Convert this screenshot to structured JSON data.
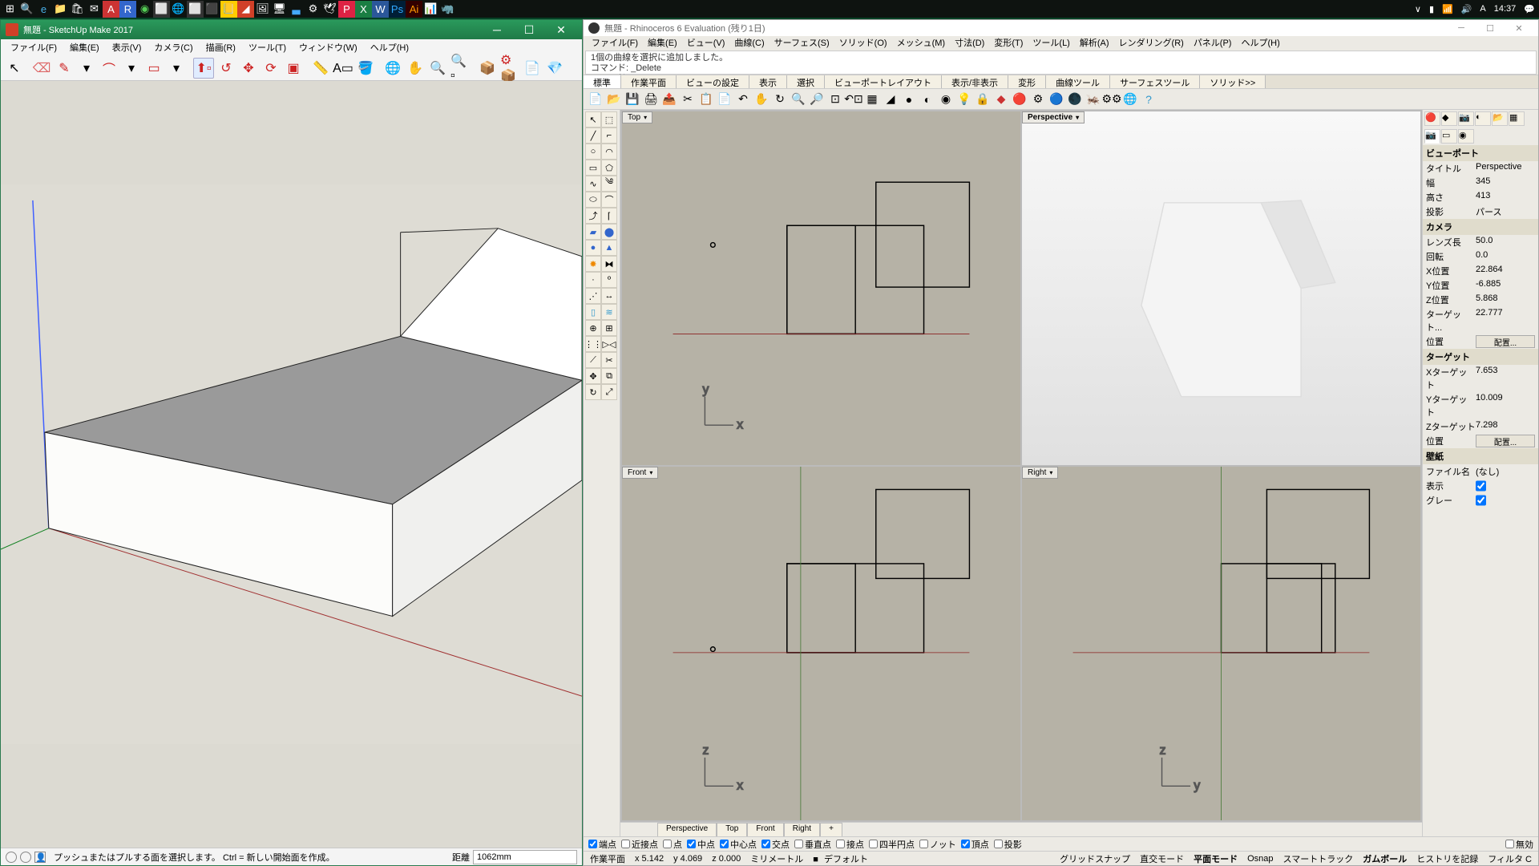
{
  "taskbar": {
    "time": "14:37",
    "indicators": [
      "∨",
      "📶",
      "🔊",
      "A",
      "14:37",
      "💬"
    ]
  },
  "sketchup": {
    "title": "無題 - SketchUp Make 2017",
    "menu": [
      "ファイル(F)",
      "編集(E)",
      "表示(V)",
      "カメラ(C)",
      "描画(R)",
      "ツール(T)",
      "ウィンドウ(W)",
      "ヘルプ(H)"
    ],
    "status_hint": "プッシュまたはプルする面を選択します。 Ctrl = 新しい開始面を作成。",
    "distance_label": "距離",
    "distance_value": "1062mm"
  },
  "rhino": {
    "title": "無題 - Rhinoceros 6 Evaluation (残り1日)",
    "menu": [
      "ファイル(F)",
      "編集(E)",
      "ビュー(V)",
      "曲線(C)",
      "サーフェス(S)",
      "ソリッド(O)",
      "メッシュ(M)",
      "寸法(D)",
      "変形(T)",
      "ツール(L)",
      "解析(A)",
      "レンダリング(R)",
      "パネル(P)",
      "ヘルプ(H)"
    ],
    "cmd_history": "1個の曲線を選択に追加しました。",
    "cmd_last": "コマンド: _Delete",
    "cmd_prompt": "コマンド:",
    "tabs": [
      "標準",
      "作業平面",
      "ビューの設定",
      "表示",
      "選択",
      "ビューポートレイアウト",
      "表示/非表示",
      "変形",
      "曲線ツール",
      "サーフェスツール",
      "ソリッド>>"
    ],
    "views": {
      "top": "Top",
      "persp": "Perspective",
      "front": "Front",
      "right": "Right"
    },
    "vtabs": [
      "Perspective",
      "Top",
      "Front",
      "Right",
      "+"
    ],
    "osnap": [
      {
        "label": "端点",
        "checked": true
      },
      {
        "label": "近接点",
        "checked": false
      },
      {
        "label": "点",
        "checked": false
      },
      {
        "label": "中点",
        "checked": true
      },
      {
        "label": "中心点",
        "checked": true
      },
      {
        "label": "交点",
        "checked": true
      },
      {
        "label": "垂直点",
        "checked": false
      },
      {
        "label": "接点",
        "checked": false
      },
      {
        "label": "四半円点",
        "checked": false
      },
      {
        "label": "ノット",
        "checked": false
      },
      {
        "label": "頂点",
        "checked": true
      },
      {
        "label": "投影",
        "checked": false
      },
      {
        "label": "無効",
        "checked": false
      }
    ],
    "props": {
      "sec_viewport": "ビューポート",
      "title_l": "タイトル",
      "title_v": "Perspective",
      "width_l": "幅",
      "width_v": "345",
      "height_l": "高さ",
      "height_v": "413",
      "proj_l": "投影",
      "proj_v": "パース",
      "sec_camera": "カメラ",
      "lens_l": "レンズ長",
      "lens_v": "50.0",
      "rot_l": "回転",
      "rot_v": "0.0",
      "xpos_l": "X位置",
      "xpos_v": "22.864",
      "ypos_l": "Y位置",
      "ypos_v": "-6.885",
      "zpos_l": "Z位置",
      "zpos_v": "5.868",
      "tgt_l": "ターゲット...",
      "tgt_v": "22.777",
      "pos_l": "位置",
      "pos_btn": "配置...",
      "sec_target": "ターゲット",
      "xt_l": "Xターゲット",
      "xt_v": "7.653",
      "yt_l": "Yターゲット",
      "yt_v": "10.009",
      "zt_l": "Zターゲット",
      "zt_v": "7.298",
      "sec_wall": "壁紙",
      "file_l": "ファイル名",
      "file_v": "(なし)",
      "show_l": "表示",
      "gray_l": "グレー"
    },
    "status": {
      "cplane": "作業平面",
      "x": "x 5.142",
      "y": "y 4.069",
      "z": "z 0.000",
      "units": "ミリメートル",
      "layer": "デフォルト",
      "items": [
        "グリッドスナップ",
        "直交モード",
        "平面モード",
        "Osnap",
        "スマートトラック",
        "ガムボール",
        "ヒストリを記録",
        "フィルタ C"
      ]
    }
  }
}
